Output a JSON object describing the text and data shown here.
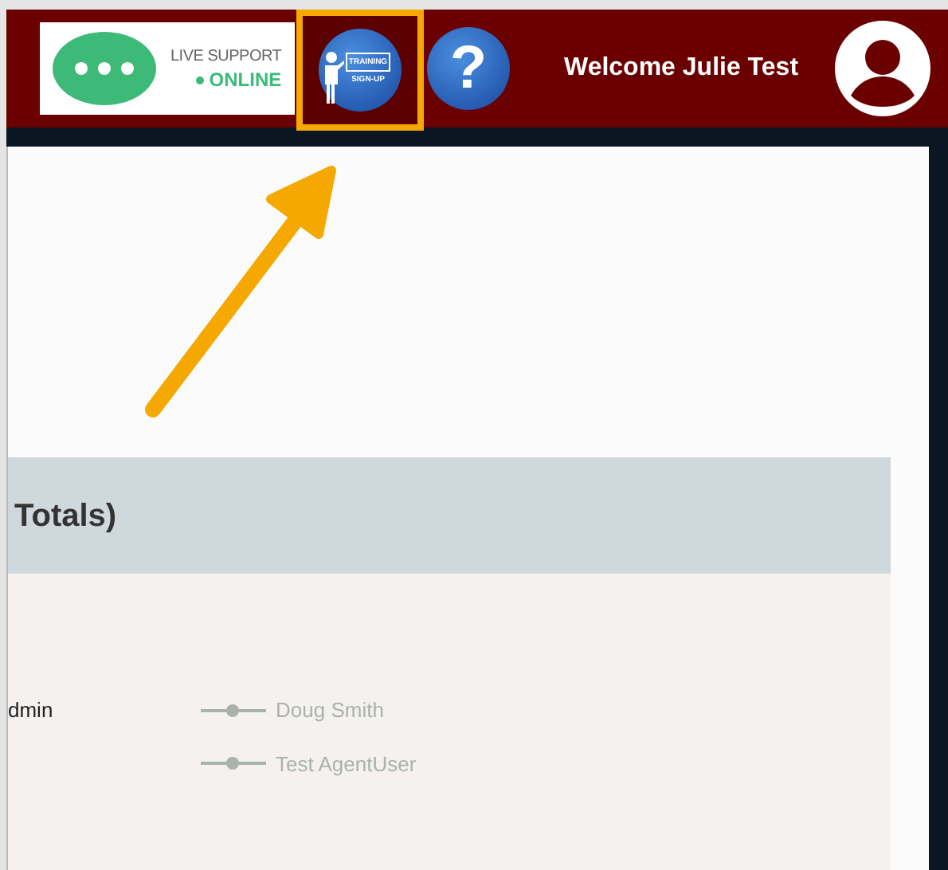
{
  "header": {
    "support": {
      "label": "LIVE SUPPORT",
      "status": "ONLINE",
      "online": true
    },
    "training_button": {
      "lines": [
        "TRAINING",
        "SIGN-UP"
      ],
      "highlighted": true
    },
    "help_button": {
      "label": "?"
    },
    "welcome": "Welcome Julie Test"
  },
  "panel": {
    "title": "Totals)",
    "row_label": "dmin",
    "legend": [
      {
        "name": "Doug Smith"
      },
      {
        "name": "Test AgentUser"
      }
    ]
  }
}
